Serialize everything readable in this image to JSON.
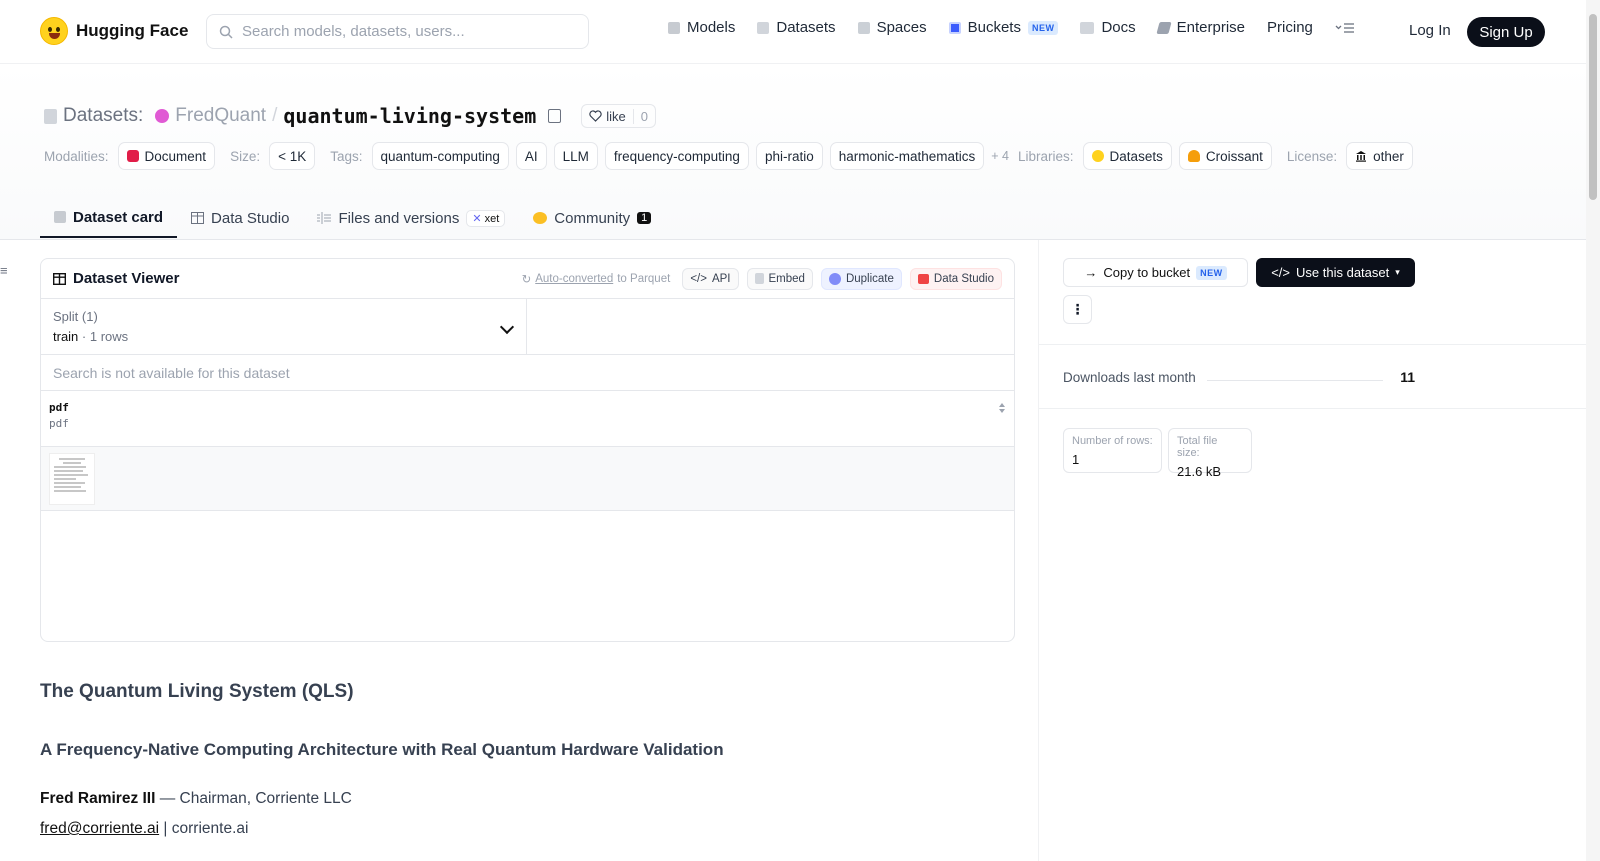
{
  "nav": {
    "logo_text": "Hugging Face",
    "search_placeholder": "Search models, datasets, users...",
    "links": [
      {
        "label": "Models",
        "icon": "cube-icon"
      },
      {
        "label": "Datasets",
        "icon": "database-icon"
      },
      {
        "label": "Spaces",
        "icon": "grid-icon"
      },
      {
        "label": "Buckets",
        "icon": "bucket-icon",
        "badge": "NEW"
      },
      {
        "label": "Docs",
        "icon": "book-icon"
      },
      {
        "label": "Enterprise",
        "icon": "enterprise-icon"
      },
      {
        "label": "Pricing"
      }
    ],
    "login": "Log In",
    "signup": "Sign Up"
  },
  "header": {
    "section": "Datasets:",
    "owner": "FredQuant",
    "separator": "/",
    "repo": "quantum-living-system",
    "like_label": "like",
    "like_count": "0",
    "modalities_label": "Modalities:",
    "modality": "Document",
    "size_label": "Size:",
    "size": "< 1K",
    "tags_label": "Tags:",
    "tags": [
      "quantum-computing",
      "AI",
      "LLM",
      "frequency-computing",
      "phi-ratio",
      "harmonic-mathematics"
    ],
    "tags_more": "+ 4",
    "libraries_label": "Libraries:",
    "libraries": [
      "Datasets",
      "Croissant"
    ],
    "license_label": "License:",
    "license": "other"
  },
  "tabs": [
    {
      "label": "Dataset card",
      "active": true
    },
    {
      "label": "Data Studio"
    },
    {
      "label": "Files and versions",
      "badge": "xet"
    },
    {
      "label": "Community",
      "count": "1"
    }
  ],
  "viewer": {
    "title": "Dataset Viewer",
    "auto_converted": "Auto-converted",
    "auto_suffix": "to Parquet",
    "buttons": [
      "API",
      "Embed",
      "Duplicate",
      "Data Studio"
    ],
    "split_label": "Split (1)",
    "split_name": "train",
    "split_rows": "1 rows",
    "search_na": "Search is not available for this dataset",
    "column_name": "pdf",
    "column_type": "pdf"
  },
  "card": {
    "title": "The Quantum Living System (QLS)",
    "subtitle": "A Frequency-Native Computing Architecture with Real Quantum Hardware Validation",
    "author": "Fred Ramirez III",
    "author_role": " — Chairman, Corriente LLC",
    "email": "fred@corriente.ai",
    "site": " | corriente.ai"
  },
  "sidebar": {
    "copy_bucket": "Copy to bucket",
    "copy_bucket_badge": "NEW",
    "use_dataset": "Use this dataset",
    "downloads_label": "Downloads last month",
    "downloads_value": "11",
    "rows_label": "Number of rows:",
    "rows_value": "1",
    "size_label": "Total file size:",
    "size_value": "21.6 kB"
  },
  "colors": {
    "accent_dark": "#0b0f19",
    "owner_avatar": "#e05ad4",
    "new_badge": "#2563eb"
  }
}
